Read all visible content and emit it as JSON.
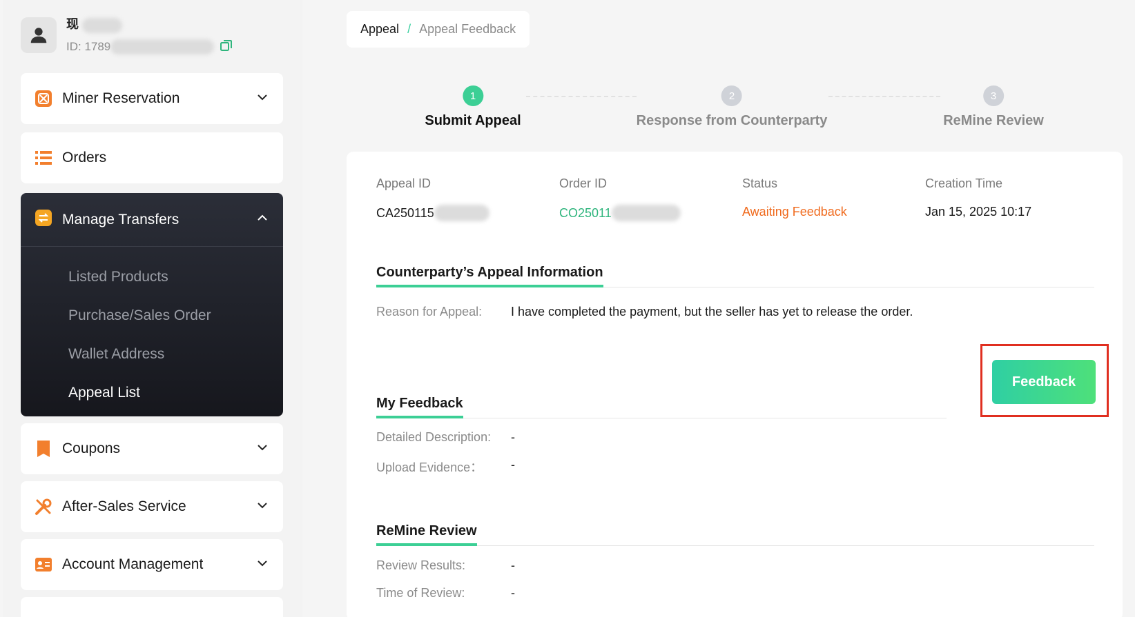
{
  "user": {
    "name": "现",
    "id": "ID: 1789"
  },
  "sidebar": {
    "miner_reservation": "Miner Reservation",
    "orders": "Orders",
    "manage_transfers": "Manage Transfers",
    "sub_items": [
      "Listed Products",
      "Purchase/Sales Order",
      "Wallet Address",
      "Appeal List"
    ],
    "coupons": "Coupons",
    "after_sales": "After-Sales Service",
    "account_management": "Account Management"
  },
  "breadcrumb": {
    "root": "Appeal",
    "separator": "/",
    "current": "Appeal Feedback"
  },
  "steps": [
    {
      "num": "1",
      "label": "Submit Appeal"
    },
    {
      "num": "2",
      "label": "Response from Counterparty"
    },
    {
      "num": "3",
      "label": "ReMine Review"
    }
  ],
  "meta": {
    "appeal_id_label": "Appeal ID",
    "appeal_id": "CA250115",
    "order_id_label": "Order ID",
    "order_id": "CO25011",
    "status_label": "Status",
    "status": "Awaiting Feedback",
    "creation_time_label": "Creation Time",
    "creation_time": "Jan 15, 2025 10:17"
  },
  "counterparty": {
    "title": "Counterparty’s Appeal Information",
    "reason_label": "Reason for Appeal:",
    "reason": "I have completed the payment, but the seller has yet to release the order."
  },
  "feedback_button": "Feedback",
  "my_feedback": {
    "title": "My Feedback",
    "desc_label": "Detailed Description:",
    "desc_value": "-",
    "evidence_label": "Upload Evidence：",
    "evidence_value": "-"
  },
  "review": {
    "title": "ReMine Review",
    "results_label": "Review Results:",
    "results_value": "-",
    "time_label": "Time of Review:",
    "time_value": "-"
  },
  "colors": {
    "accent": "#3ccf95",
    "status_orange": "#f06a1d",
    "order_green": "#2fb57d",
    "step_inactive": "#cfd2d8",
    "highlight_red": "#e02f20"
  },
  "icons": [
    "user-avatar-icon",
    "copy-icon",
    "miner-icon",
    "orders-list-icon",
    "transfer-icon",
    "coupon-icon",
    "tools-icon",
    "id-card-icon",
    "chevron-down-icon",
    "chevron-up-icon"
  ]
}
